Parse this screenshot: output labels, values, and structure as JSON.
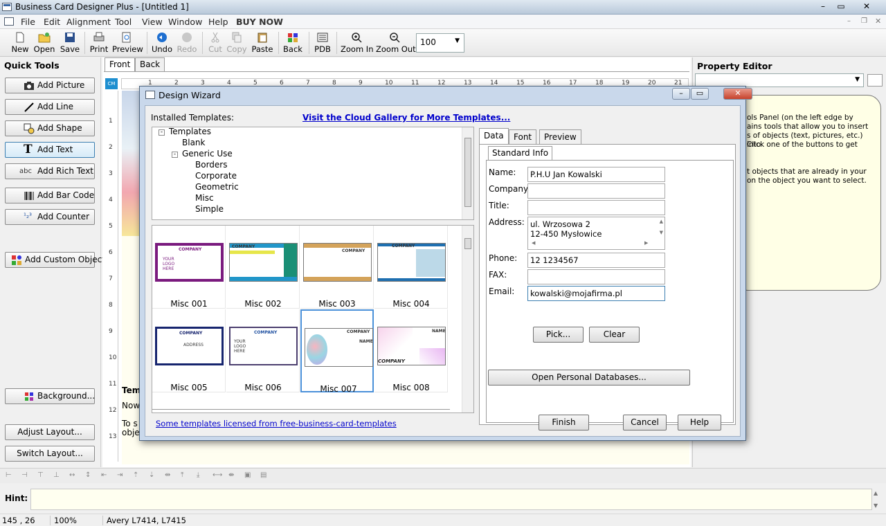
{
  "app": {
    "title": "Business Card Designer Plus  - [Untitled 1]"
  },
  "menu": [
    "File",
    "Edit",
    "Alignment",
    "Tool",
    "View",
    "Window",
    "Help",
    "BUY NOW"
  ],
  "toolbar": {
    "new": "New",
    "open": "Open",
    "save": "Save",
    "print": "Print",
    "preview": "Preview",
    "undo": "Undo",
    "redo": "Redo",
    "cut": "Cut",
    "copy": "Copy",
    "paste": "Paste",
    "back": "Back",
    "pdb": "PDB",
    "zoom_in": "Zoom In",
    "zoom_out": "Zoom Out",
    "zoom_value": "100"
  },
  "quick_tools": {
    "title": "Quick Tools",
    "add_picture": "Add Picture",
    "add_line": "Add Line",
    "add_shape": "Add Shape",
    "add_text": "Add Text",
    "add_rich_text": "Add Rich Text",
    "add_bar_code": "Add Bar Code",
    "add_counter": "Add Counter",
    "add_custom_object": "Add Custom Object",
    "background": "Background...",
    "adjust_layout": "Adjust Layout...",
    "switch_layout": "Switch Layout..."
  },
  "canvas": {
    "tab_front": "Front",
    "tab_back": "Back",
    "unit": "CM",
    "ruler_h": [
      "1",
      "2",
      "3",
      "4",
      "5",
      "6",
      "7",
      "8",
      "9",
      "10",
      "11",
      "12",
      "13",
      "14",
      "15",
      "16",
      "17",
      "18",
      "19",
      "20",
      "21"
    ],
    "ruler_v": [
      "1",
      "2",
      "3",
      "4",
      "5",
      "6",
      "7",
      "8",
      "9",
      "10",
      "11",
      "12",
      "13"
    ],
    "tip_title": "Tem",
    "tip_line1": "Now",
    "tip_line2": "To s",
    "tip_line3": "obje"
  },
  "property_editor": {
    "title": "Property Editor",
    "help1": "ols Panel (on the left edge by",
    "help2": "ains tools that allow you to insert",
    "help3": "s of objects (text, pictures, etc.) into",
    "help4": "Click one of the buttons to get",
    "help5": "t objects that are already in your",
    "help6": "on the object you want to select."
  },
  "hint": {
    "label": "Hint:"
  },
  "status": {
    "coords": "145 , 26",
    "zoom": "100%",
    "paper": "Avery L7414, L7415"
  },
  "wizard": {
    "title": "Design Wizard",
    "installed_label": "Installed Templates:",
    "cloud_link": "Visit the Cloud Gallery for More Templates...",
    "tree": [
      "Templates",
      "Blank",
      "Generic Use",
      "Borders",
      "Corporate",
      "Geometric",
      "Misc",
      "Simple"
    ],
    "templates": [
      "Misc 001",
      "Misc 002",
      "Misc 003",
      "Misc 004",
      "Misc 005",
      "Misc 006",
      "Misc 007",
      "Misc 008"
    ],
    "license_link": "Some templates licensed from free-business-card-templates",
    "tabs": [
      "Data",
      "Font",
      "Preview"
    ],
    "subtab": "Standard Info",
    "fields": {
      "name_label": "Name:",
      "name": "P.H.U Jan Kowalski",
      "company_label": "Company:",
      "company": "",
      "title_label": "Title:",
      "title": "",
      "address_label": "Address:",
      "address_line1": "ul. Wrzosowa 2",
      "address_line2": "12-450 Mysłowice",
      "phone_label": "Phone:",
      "phone": "12 1234567",
      "fax_label": "FAX:",
      "fax": "",
      "email_label": "Email:",
      "email": "kowalski@mojafirma.pl"
    },
    "pick": "Pick...",
    "clear": "Clear",
    "open_db": "Open Personal Databases...",
    "finish": "Finish",
    "cancel": "Cancel",
    "help": "Help"
  },
  "card_text": {
    "company": "COMPANY",
    "logo": "YOUR LOGO HERE",
    "name": "NAME",
    "address": "ADDRESS"
  },
  "colors": {
    "accent": "#1e8fd0",
    "link": "#0000cc",
    "selection": "#4a90d9",
    "hint_bg": "#fffff0"
  }
}
